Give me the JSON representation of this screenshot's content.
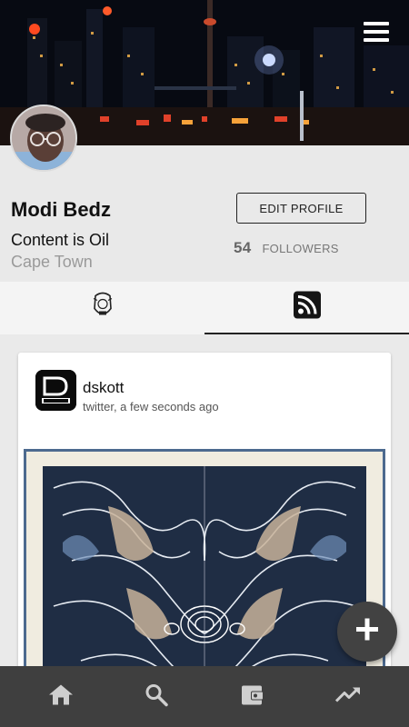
{
  "header": {
    "cover_image": "city-night-skyline-image",
    "menu_icon": "hamburger-menu-icon"
  },
  "profile": {
    "name": "Modi Bedz",
    "bio": "Content is Oil",
    "location": "Cape Town",
    "edit_label": "EDIT PROFILE",
    "followers_count": "54",
    "followers_label": "FOLLOWERS"
  },
  "tabs": [
    {
      "icon": "crest-logo-icon",
      "active": false
    },
    {
      "icon": "rss-feed-icon",
      "active": true
    }
  ],
  "post": {
    "username": "dskott",
    "meta": "twitter, a few seconds ago",
    "avatar_icon": "dskott-logo-icon",
    "image": "abstract-symmetric-art-image"
  },
  "fab": {
    "icon": "plus-icon"
  },
  "bottom_nav": [
    {
      "icon": "home-icon"
    },
    {
      "icon": "search-icon"
    },
    {
      "icon": "wallet-icon"
    },
    {
      "icon": "trending-up-icon"
    }
  ],
  "colors": {
    "nav_bg": "#3f3f3f",
    "fab_bg": "#424242",
    "card_bg": "#ffffff",
    "page_bg": "#eaeaea",
    "accent_border": "#4d6a8f"
  }
}
